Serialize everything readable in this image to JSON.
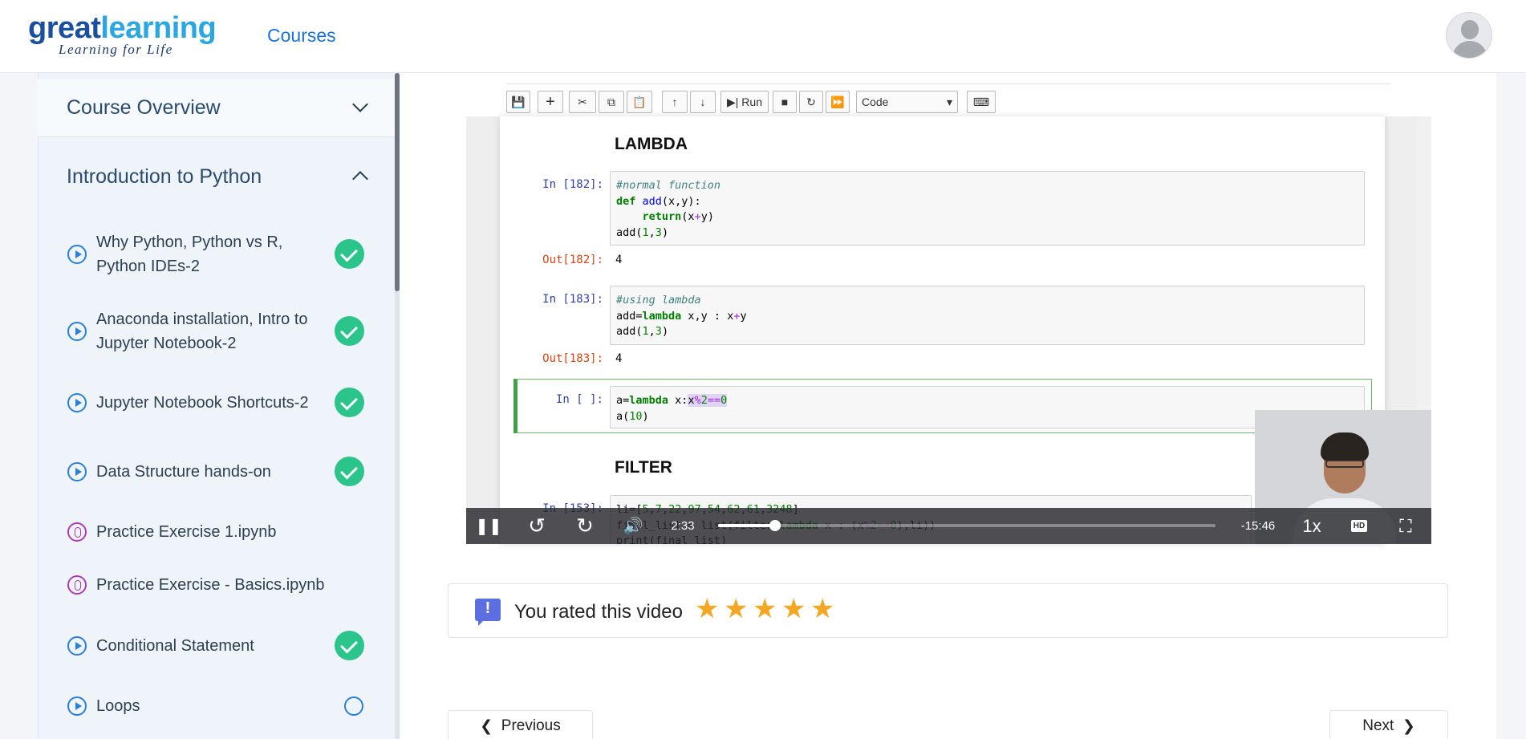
{
  "header": {
    "logo_great": "great",
    "logo_learning": "learning",
    "logo_tagline": "Learning for Life",
    "nav_courses": "Courses"
  },
  "sidebar": {
    "sections": [
      {
        "title": "Course Overview",
        "expanded": false
      },
      {
        "title": "Introduction to Python",
        "expanded": true
      }
    ],
    "items": [
      {
        "label": "Why Python, Python vs R, Python IDEs-2",
        "type": "video",
        "status": "complete"
      },
      {
        "label": "Anaconda installation, Intro to Jupyter Notebook-2",
        "type": "video",
        "status": "complete"
      },
      {
        "label": "Jupyter Notebook Shortcuts-2",
        "type": "video",
        "status": "complete"
      },
      {
        "label": "Data Structure hands-on",
        "type": "video",
        "status": "complete"
      },
      {
        "label": "Practice Exercise 1.ipynb",
        "type": "attachment",
        "status": "none"
      },
      {
        "label": "Practice Exercise - Basics.ipynb",
        "type": "attachment",
        "status": "none"
      },
      {
        "label": "Conditional Statement",
        "type": "video",
        "status": "complete"
      },
      {
        "label": "Loops",
        "type": "video",
        "status": "incomplete"
      }
    ]
  },
  "notebook": {
    "toolbar": {
      "run_label": "Run",
      "cell_type": "Code"
    },
    "heading_lambda": "LAMBDA",
    "heading_filter": "FILTER",
    "cells": [
      {
        "prompt": "In [182]:",
        "out_prompt": "Out[182]:",
        "out_value": "4"
      },
      {
        "prompt": "In [183]:",
        "out_prompt": "Out[183]:",
        "out_value": "4"
      },
      {
        "prompt": "In [ ]:"
      },
      {
        "prompt": "In [153]:"
      }
    ]
  },
  "player": {
    "current_time": "2:33",
    "remaining_time": "-15:46",
    "speed": "1x",
    "progress": 0.115,
    "state": "playing"
  },
  "rating": {
    "text": "You rated this video",
    "stars": 5,
    "max_stars": 5
  },
  "navigation": {
    "previous_label": "Previous",
    "next_label": "Next"
  },
  "colors": {
    "accent": "#1a73d9",
    "complete": "#2bc48a",
    "star": "#f5a623"
  }
}
